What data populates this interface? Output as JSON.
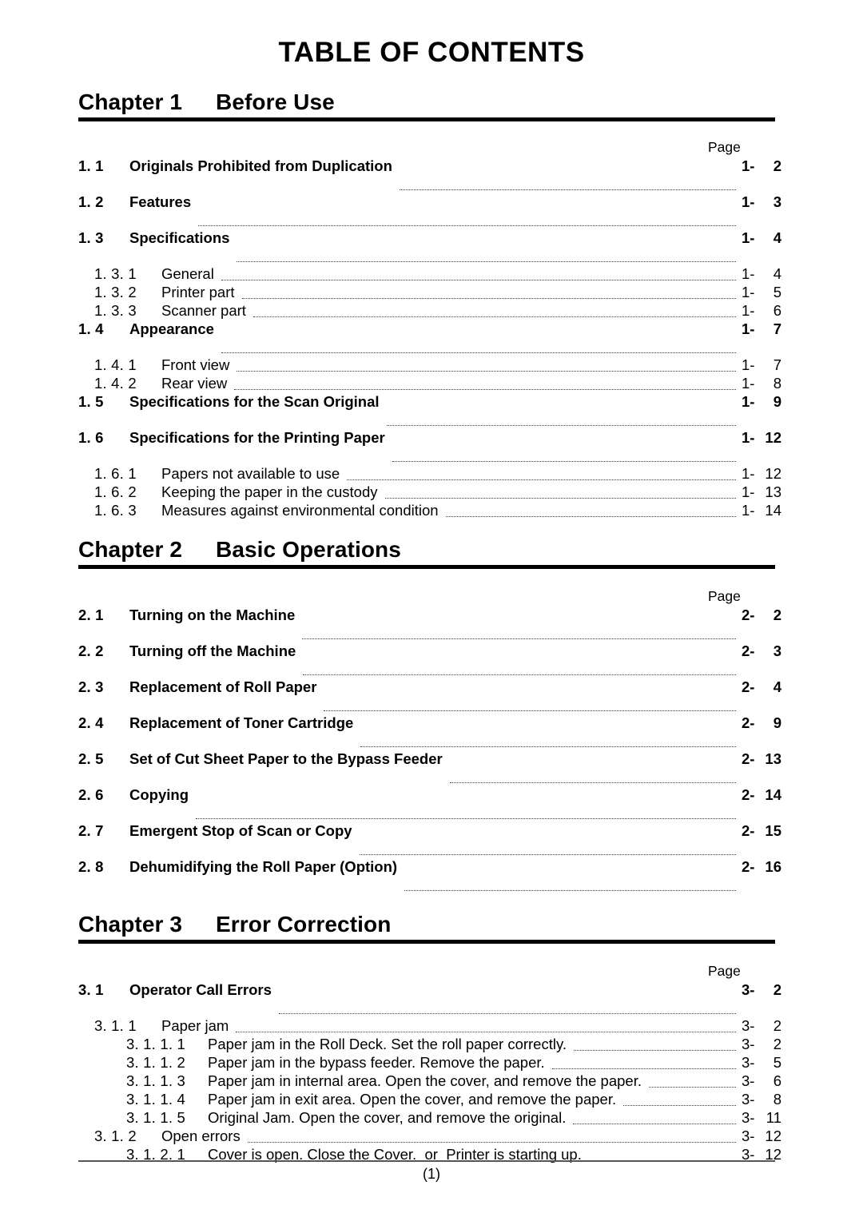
{
  "document": {
    "title": "TABLE OF CONTENTS",
    "footer_page": "(1)",
    "page_column_header": "Page"
  },
  "chapters": [
    {
      "label": "Chapter 1",
      "name": "Before Use",
      "page_header": "Page",
      "entries": [
        {
          "level": 2,
          "number": "1. 1",
          "title": "Originals Prohibited from Duplication",
          "page_prefix": "1-",
          "page_value": "2"
        },
        {
          "level": 2,
          "number": "1. 2",
          "title": "Features",
          "page_prefix": "1-",
          "page_value": "3"
        },
        {
          "level": 2,
          "number": "1. 3",
          "title": "Specifications",
          "page_prefix": "1-",
          "page_value": "4"
        },
        {
          "level": 3,
          "number": "1. 3. 1",
          "title": "General",
          "page_prefix": "1-",
          "page_value": "4"
        },
        {
          "level": 3,
          "number": "1. 3. 2",
          "title": "Printer part",
          "page_prefix": "1-",
          "page_value": "5"
        },
        {
          "level": 3,
          "number": "1. 3. 3",
          "title": "Scanner part",
          "page_prefix": "1-",
          "page_value": "6"
        },
        {
          "level": 2,
          "number": "1. 4",
          "title": "Appearance",
          "page_prefix": "1-",
          "page_value": "7"
        },
        {
          "level": 3,
          "number": "1. 4. 1",
          "title": "Front view",
          "page_prefix": "1-",
          "page_value": "7"
        },
        {
          "level": 3,
          "number": "1. 4. 2",
          "title": "Rear view",
          "page_prefix": "1-",
          "page_value": "8"
        },
        {
          "level": 2,
          "number": "1. 5",
          "title": "Specifications for the Scan Original",
          "page_prefix": "1-",
          "page_value": "9"
        },
        {
          "level": 2,
          "number": "1. 6",
          "title": "Specifications for the Printing Paper",
          "page_prefix": "1-",
          "page_value": "12"
        },
        {
          "level": 3,
          "number": "1. 6. 1",
          "title": "Papers not available to use",
          "page_prefix": "1-",
          "page_value": "12"
        },
        {
          "level": 3,
          "number": "1. 6. 2",
          "title": "Keeping the paper in the custody",
          "page_prefix": "1-",
          "page_value": "13"
        },
        {
          "level": 3,
          "number": "1. 6. 3",
          "title": "Measures against environmental condition",
          "page_prefix": "1-",
          "page_value": "14"
        }
      ]
    },
    {
      "label": "Chapter 2",
      "name": "Basic Operations",
      "page_header": "Page",
      "entries": [
        {
          "level": 2,
          "number": "2. 1",
          "title": "Turning on the Machine",
          "page_prefix": "2-",
          "page_value": "2"
        },
        {
          "level": 2,
          "number": "2. 2",
          "title": "Turning off the Machine",
          "page_prefix": "2-",
          "page_value": "3"
        },
        {
          "level": 2,
          "number": "2. 3",
          "title": "Replacement of Roll Paper",
          "page_prefix": "2-",
          "page_value": "4"
        },
        {
          "level": 2,
          "number": "2. 4",
          "title": "Replacement of Toner Cartridge",
          "page_prefix": "2-",
          "page_value": "9"
        },
        {
          "level": 2,
          "number": "2. 5",
          "title": "Set of Cut Sheet Paper to the Bypass Feeder",
          "page_prefix": "2-",
          "page_value": "13"
        },
        {
          "level": 2,
          "number": "2. 6",
          "title": "Copying",
          "page_prefix": "2-",
          "page_value": "14"
        },
        {
          "level": 2,
          "number": "2. 7",
          "title": "Emergent Stop of Scan or Copy",
          "page_prefix": "2-",
          "page_value": "15"
        },
        {
          "level": 2,
          "number": "2. 8",
          "title": "Dehumidifying the Roll Paper (Option)",
          "page_prefix": "2-",
          "page_value": "16"
        }
      ]
    },
    {
      "label": "Chapter 3",
      "name": "Error Correction",
      "page_header": "Page",
      "entries": [
        {
          "level": 2,
          "number": "3. 1",
          "title": "Operator Call Errors",
          "page_prefix": "3-",
          "page_value": "2"
        },
        {
          "level": 3,
          "number": "3. 1. 1",
          "title": "Paper jam",
          "page_prefix": "3-",
          "page_value": "2"
        },
        {
          "level": 4,
          "number": "3. 1. 1. 1",
          "title": "Paper jam in the Roll Deck. Set the roll paper correctly.",
          "page_prefix": "3-",
          "page_value": "2"
        },
        {
          "level": 4,
          "number": "3. 1. 1. 2",
          "title": "Paper jam in the bypass feeder. Remove the paper.",
          "page_prefix": "3-",
          "page_value": "5"
        },
        {
          "level": 4,
          "number": "3. 1. 1. 3",
          "title": "Paper jam in internal area. Open the cover, and remove the paper.",
          "page_prefix": "3-",
          "page_value": "6"
        },
        {
          "level": 4,
          "number": "3. 1. 1. 4",
          "title": "Paper jam in exit area. Open the cover, and remove the paper.",
          "page_prefix": "3-",
          "page_value": "8"
        },
        {
          "level": 4,
          "number": "3. 1. 1. 5",
          "title": "Original Jam. Open the cover, and remove the original.",
          "page_prefix": "3-",
          "page_value": "11"
        },
        {
          "level": 3,
          "number": "3. 1. 2",
          "title": "Open errors",
          "page_prefix": "3-",
          "page_value": "12"
        },
        {
          "level": 4,
          "number": "3. 1. 2. 1",
          "title": "Cover is open. Close the Cover.  or  Printer is starting up.",
          "page_prefix": "3-",
          "page_value": "12"
        }
      ]
    }
  ]
}
